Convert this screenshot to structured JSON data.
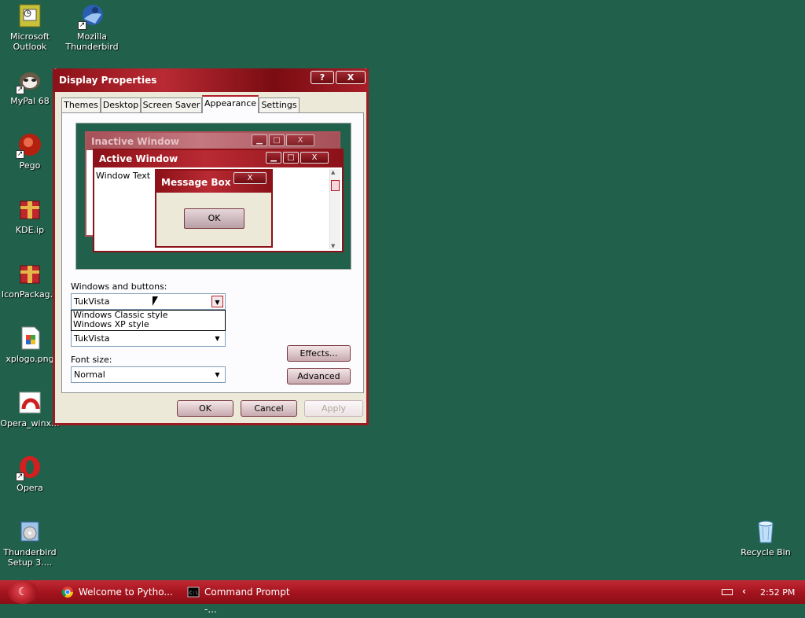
{
  "desktop_icons": [
    {
      "label": "Microsoft Outlook",
      "icon": "outlook-icon"
    },
    {
      "label": "Mozilla Thunderbird",
      "icon": "thunderbird-icon"
    },
    {
      "label": "MyPal 68",
      "icon": "mypal-icon"
    },
    {
      "label": "Pego",
      "icon": "pego-icon"
    },
    {
      "label": "KDE.ip",
      "icon": "archive-icon"
    },
    {
      "label": "IconPackag...",
      "icon": "archive-icon"
    },
    {
      "label": "xplogo.png",
      "icon": "image-file-icon"
    },
    {
      "label": "Opera_winx...",
      "icon": "opera-installer-icon"
    },
    {
      "label": "Opera",
      "icon": "opera-icon"
    },
    {
      "label": "Thunderbird Setup 3....",
      "icon": "setup-icon"
    },
    {
      "label": "Recycle Bin",
      "icon": "recycle-bin-icon"
    }
  ],
  "window": {
    "title": "Display Properties",
    "help_label": "?",
    "close_label": "X",
    "tabs": [
      "Themes",
      "Desktop",
      "Screen Saver",
      "Appearance",
      "Settings"
    ],
    "active_tab": "Appearance"
  },
  "preview": {
    "inactive_title": "Inactive Window",
    "active_title": "Active Window",
    "window_text": "Window Text",
    "message_title": "Message Box",
    "message_ok": "OK",
    "min_glyph": "▁",
    "max_glyph": "□",
    "close_glyph": "X"
  },
  "appearance": {
    "windows_buttons_label": "Windows and buttons:",
    "windows_buttons_value": "TukVista",
    "options": [
      "Windows Classic style",
      "Windows XP style"
    ],
    "color_scheme_value": "TukVista",
    "font_size_label": "Font size:",
    "font_size_value": "Normal",
    "effects_label": "Effects...",
    "advanced_label": "Advanced"
  },
  "footer": {
    "ok": "OK",
    "cancel": "Cancel",
    "apply": "Apply"
  },
  "taskbar": {
    "start_glyph": "☾",
    "tasks": [
      {
        "label": "Welcome to Pytho...",
        "icon": "chrome-icon"
      },
      {
        "label": "Command Prompt -...",
        "icon": "command-prompt-icon"
      }
    ],
    "clock": "2:52 PM"
  },
  "colors": {
    "accent": "#9b1b22",
    "desktop": "#21604a"
  }
}
